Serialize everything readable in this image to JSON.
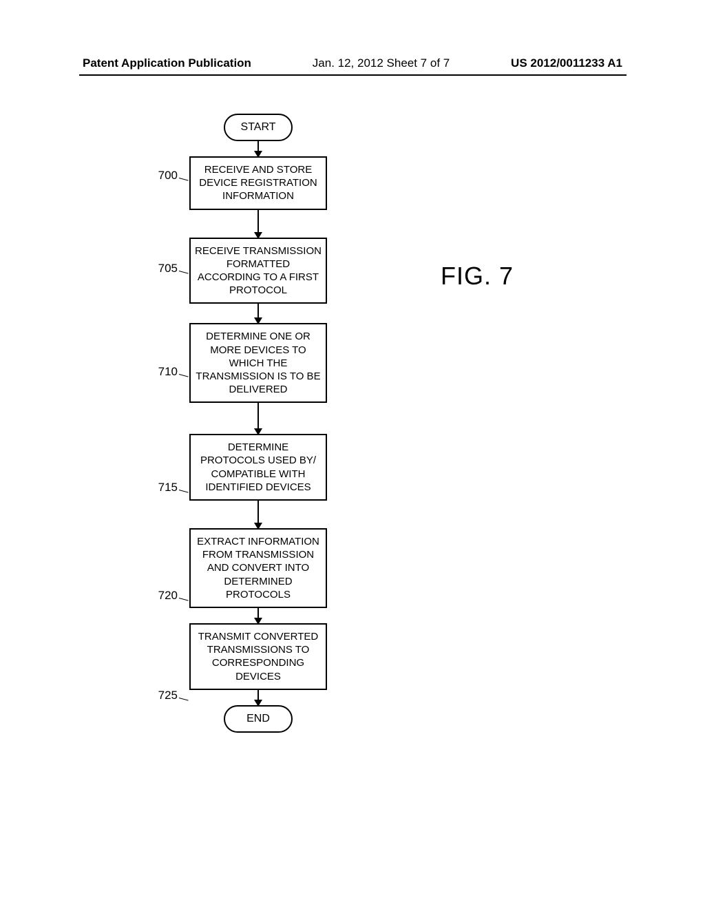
{
  "header": {
    "left": "Patent Application Publication",
    "center": "Jan. 12, 2012  Sheet 7 of 7",
    "right": "US 2012/0011233 A1"
  },
  "figure_label": "FIG. 7",
  "terminators": {
    "start": "START",
    "end": "END"
  },
  "steps": [
    {
      "ref": "700",
      "text": "RECEIVE AND STORE DEVICE REGISTRATION INFORMATION"
    },
    {
      "ref": "705",
      "text": "RECEIVE TRANSMISSION FORMATTED ACCORDING TO A FIRST PROTOCOL"
    },
    {
      "ref": "710",
      "text": "DETERMINE ONE OR MORE DEVICES TO WHICH THE TRANSMISSION IS TO BE DELIVERED"
    },
    {
      "ref": "715",
      "text": "DETERMINE PROTOCOLS USED BY/ COMPATIBLE WITH IDENTIFIED DEVICES"
    },
    {
      "ref": "720",
      "text": "EXTRACT INFORMATION FROM TRANSMISSION AND CONVERT INTO DETERMINED PROTOCOLS"
    },
    {
      "ref": "725",
      "text": "TRANSMIT CONVERTED TRANSMISSIONS TO CORRESPONDING DEVICES"
    }
  ],
  "chart_data": {
    "type": "flowchart",
    "title": "FIG. 7",
    "nodes": [
      {
        "id": "start",
        "type": "terminator",
        "label": "START"
      },
      {
        "id": "700",
        "type": "process",
        "label": "RECEIVE AND STORE DEVICE REGISTRATION INFORMATION"
      },
      {
        "id": "705",
        "type": "process",
        "label": "RECEIVE TRANSMISSION FORMATTED ACCORDING TO A FIRST PROTOCOL"
      },
      {
        "id": "710",
        "type": "process",
        "label": "DETERMINE ONE OR MORE DEVICES TO WHICH THE TRANSMISSION IS TO BE DELIVERED"
      },
      {
        "id": "715",
        "type": "process",
        "label": "DETERMINE PROTOCOLS USED BY/ COMPATIBLE WITH IDENTIFIED DEVICES"
      },
      {
        "id": "720",
        "type": "process",
        "label": "EXTRACT INFORMATION FROM TRANSMISSION AND CONVERT INTO DETERMINED PROTOCOLS"
      },
      {
        "id": "725",
        "type": "process",
        "label": "TRANSMIT CONVERTED TRANSMISSIONS TO CORRESPONDING DEVICES"
      },
      {
        "id": "end",
        "type": "terminator",
        "label": "END"
      }
    ],
    "edges": [
      {
        "from": "start",
        "to": "700"
      },
      {
        "from": "700",
        "to": "705"
      },
      {
        "from": "705",
        "to": "710"
      },
      {
        "from": "710",
        "to": "715"
      },
      {
        "from": "715",
        "to": "720"
      },
      {
        "from": "720",
        "to": "725"
      },
      {
        "from": "725",
        "to": "end"
      }
    ]
  }
}
